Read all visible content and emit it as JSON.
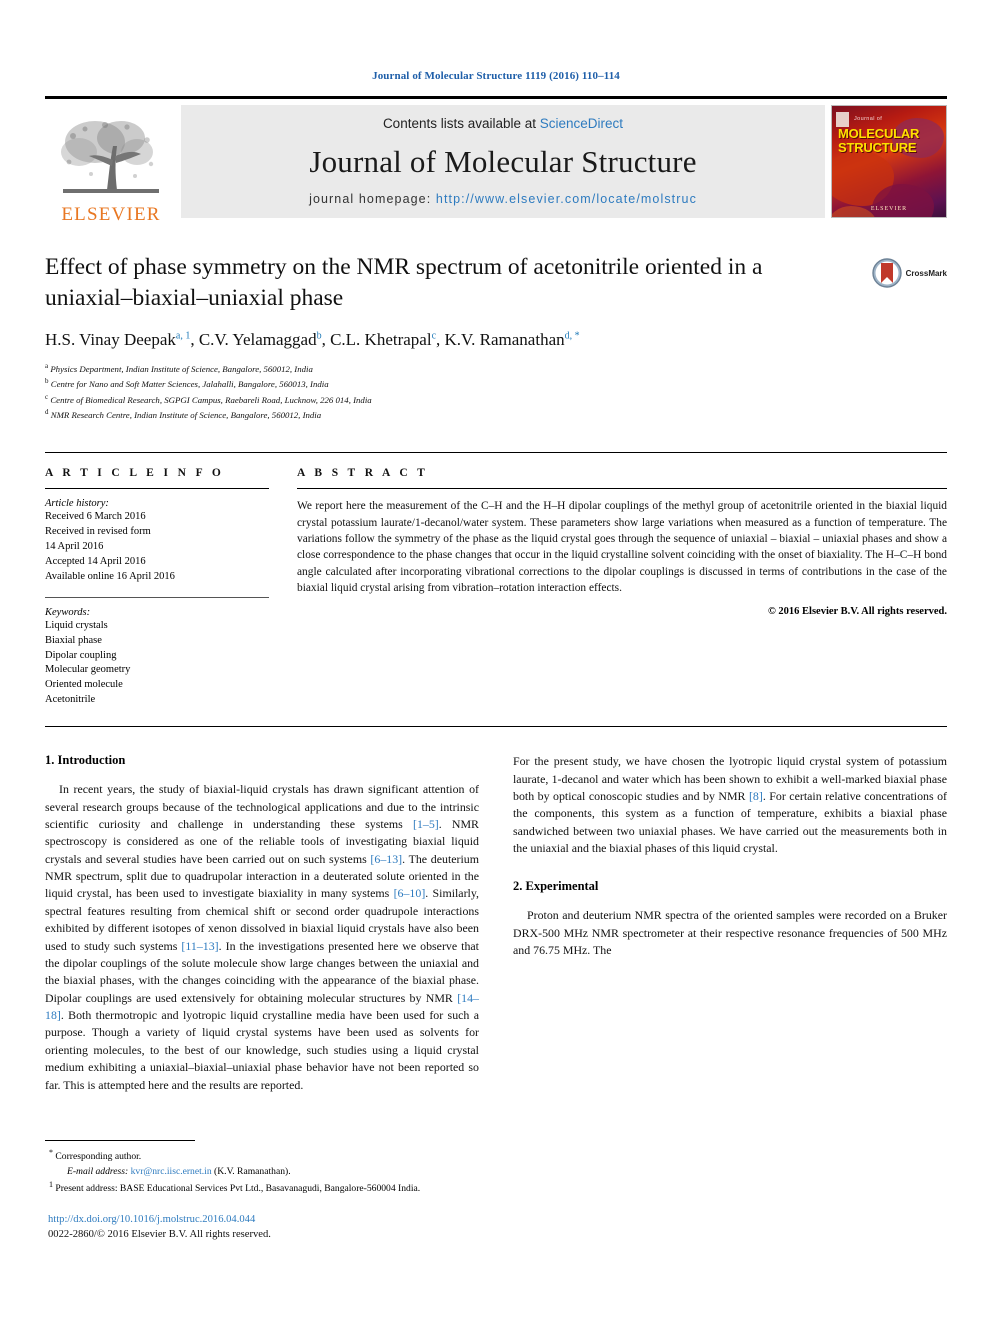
{
  "running_head": "Journal of Molecular Structure 1119 (2016) 110–114",
  "masthead": {
    "publisher_logo_text": "ELSEVIER",
    "contents_prefix": "Contents lists available at ",
    "contents_link": "ScienceDirect",
    "journal_name": "Journal of Molecular Structure",
    "homepage_prefix": "journal homepage: ",
    "homepage_url": "http://www.elsevier.com/locate/molstruc",
    "cover": {
      "title_line1": "MOLECULAR",
      "title_line2": "STRUCTURE",
      "top_label": "Journal of",
      "footer_label": "ELSEVIER"
    },
    "colors": {
      "link": "#2e7bbf",
      "elsevier_orange": "#E87722",
      "band_background": "#eaeaea"
    }
  },
  "article": {
    "title": "Effect of phase symmetry on the NMR spectrum of acetonitrile oriented in a uniaxial–biaxial–uniaxial phase",
    "crossmark_label": "CrossMark",
    "authors": [
      {
        "name": "H.S. Vinay Deepak",
        "marks": "a, 1"
      },
      {
        "name": "C.V. Yelamaggad",
        "marks": "b"
      },
      {
        "name": "C.L. Khetrapal",
        "marks": "c"
      },
      {
        "name": "K.V. Ramanathan",
        "marks": "d, *"
      }
    ],
    "affiliations": [
      {
        "mark": "a",
        "text": "Physics Department, Indian Institute of Science, Bangalore, 560012, India"
      },
      {
        "mark": "b",
        "text": "Centre for Nano and Soft Matter Sciences, Jalahalli, Bangalore, 560013, India"
      },
      {
        "mark": "c",
        "text": "Centre of Biomedical Research, SGPGI Campus, Raebareli Road, Lucknow, 226 014, India"
      },
      {
        "mark": "d",
        "text": "NMR Research Centre, Indian Institute of Science, Bangalore, 560012, India"
      }
    ]
  },
  "article_info": {
    "heading": "A R T I C L E  I N F O",
    "history_label": "Article history:",
    "history": [
      "Received 6 March 2016",
      "Received in revised form",
      "14 April 2016",
      "Accepted 14 April 2016",
      "Available online 16 April 2016"
    ],
    "keywords_label": "Keywords:",
    "keywords": [
      "Liquid crystals",
      "Biaxial phase",
      "Dipolar coupling",
      "Molecular geometry",
      "Oriented molecule",
      "Acetonitrile"
    ]
  },
  "abstract": {
    "heading": "A B S T R A C T",
    "text": "We report here the measurement of the C–H and the H–H dipolar couplings of the methyl group of acetonitrile oriented in the biaxial liquid crystal potassium laurate/1-decanol/water system. These parameters show large variations when measured as a function of temperature. The variations follow the symmetry of the phase as the liquid crystal goes through the sequence of uniaxial – biaxial – uniaxial phases and show a close correspondence to the phase changes that occur in the liquid crystalline solvent coinciding with the onset of biaxiality. The H–C–H bond angle calculated after incorporating vibrational corrections to the dipolar couplings is discussed in terms of contributions in the case of the biaxial liquid crystal arising from vibration–rotation interaction effects.",
    "copyright": "© 2016 Elsevier B.V. All rights reserved."
  },
  "body": {
    "section1_heading": "1.  Introduction",
    "intro_p1_a": "In recent years, the study of biaxial-liquid crystals has drawn significant attention of several research groups because of the technological applications and due to the intrinsic scientific curiosity and challenge in understanding these systems ",
    "intro_ref1": "[1–5]",
    "intro_p1_b": ". NMR spectroscopy is considered as one of the reliable tools of investigating biaxial liquid crystals and several studies have been carried out on such systems ",
    "intro_ref2": "[6–13]",
    "intro_p1_c": ". The deuterium NMR spectrum, split due to quadrupolar interaction in a deuterated solute oriented in the liquid crystal, has been used to investigate biaxiality in many systems ",
    "intro_ref3": "[6–10]",
    "intro_p1_d": ". Similarly, spectral features resulting from chemical shift or second order quadrupole interactions exhibited by different isotopes of xenon dissolved in biaxial liquid crystals have also been used to study such systems ",
    "intro_ref4": "[11–13]",
    "intro_p1_e": ". In the investigations presented here we observe that the dipolar couplings of the solute molecule show large changes between the uniaxial and the biaxial phases, with the changes coinciding with the appearance of the biaxial phase. Dipolar couplings are used extensively for obtaining molecular structures by NMR ",
    "intro_ref5": "[14–18]",
    "intro_p1_f": ". Both thermotropic and lyotropic liquid crystalline media have been used for such a purpose. Though a variety of liquid crystal systems have been used as solvents for orienting molecules, to the best of our knowledge, such studies using a liquid crystal medium exhibiting a uniaxial–biaxial–uniaxial phase behavior have not been reported so far. This is attempted here and the results are reported.",
    "intro_p2_a": "For the present study, we have chosen the lyotropic liquid crystal system of potassium laurate, 1-decanol and water which has been shown to exhibit a well-marked biaxial phase both by optical conoscopic studies and by NMR ",
    "intro_ref6": "[8]",
    "intro_p2_b": ". For certain relative concentrations of the components, this system as a function of temperature, exhibits a biaxial phase sandwiched between two uniaxial phases. We have carried out the measurements both in the uniaxial and the biaxial phases of this liquid crystal.",
    "section2_heading": "2.  Experimental",
    "exp_p1": "Proton and deuterium NMR spectra of the oriented samples were recorded on a Bruker DRX-500 MHz NMR spectrometer at their respective resonance frequencies of 500 MHz and 76.75 MHz. The"
  },
  "footnotes": {
    "corresponding_mark": "*",
    "corresponding_text": "Corresponding author.",
    "email_label": "E-mail address:",
    "email": "kvr@nrc.iisc.ernet.in",
    "email_owner": "(K.V. Ramanathan).",
    "present_mark": "1",
    "present_text": "Present address: BASE Educational Services Pvt Ltd., Basavanagudi, Bangalore-560004 India.",
    "doi": "http://dx.doi.org/10.1016/j.molstruc.2016.04.044",
    "issn": "0022-2860/© 2016 Elsevier B.V. All rights reserved."
  }
}
